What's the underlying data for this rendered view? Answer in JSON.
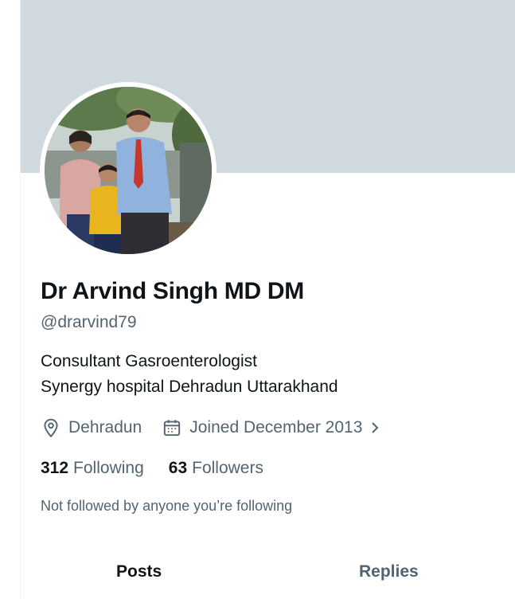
{
  "profile": {
    "display_name": "Dr Arvind Singh MD DM",
    "handle": "@drarvind79",
    "bio_line_1": "Consultant Gasroenterologist",
    "bio_line_2": "Synergy hospital Dehradun Uttarakhand",
    "location": "Dehradun",
    "joined": "Joined December 2013",
    "avatar_description": "profile photo"
  },
  "stats": {
    "following_count": "312",
    "following_label": "Following",
    "followers_count": "63",
    "followers_label": "Followers"
  },
  "social_context": "Not followed by anyone you’re following",
  "tabs": [
    {
      "label": "Posts",
      "selected": true
    },
    {
      "label": "Replies",
      "selected": false
    }
  ],
  "icons": {
    "location": "location-pin-icon",
    "joined": "calendar-icon",
    "more": "chevron-right-icon"
  },
  "colors": {
    "banner": "#cfd9de",
    "text_primary": "#0f1419",
    "text_secondary": "#536471"
  }
}
